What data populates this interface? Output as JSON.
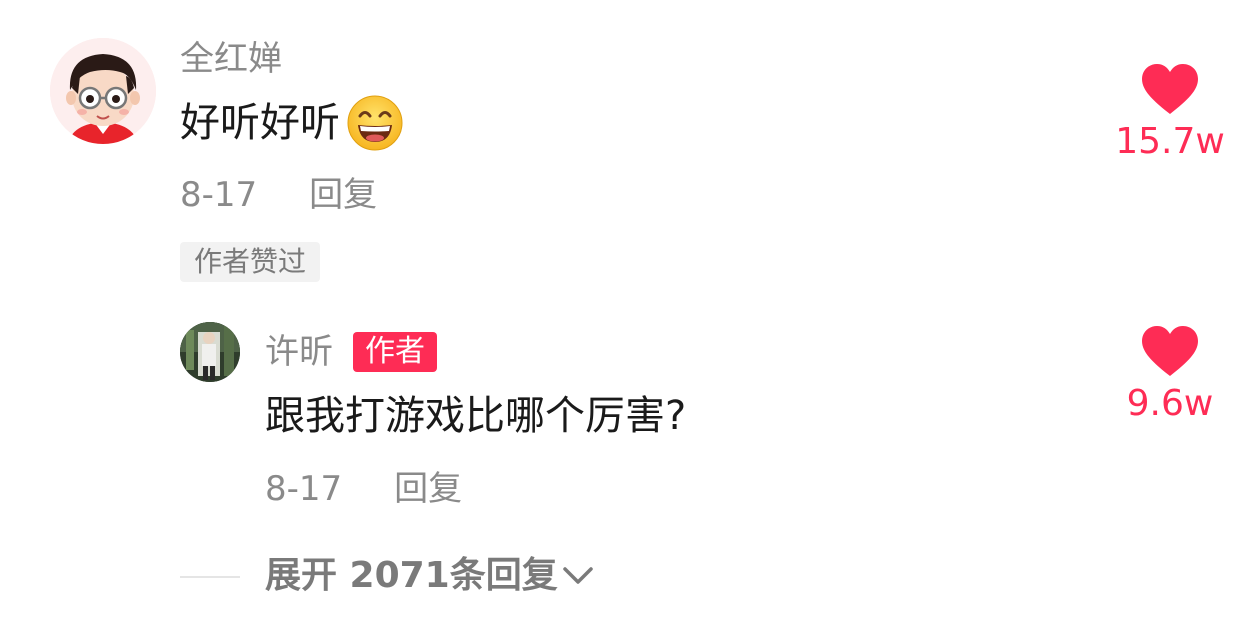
{
  "colors": {
    "accent": "#fe2c55",
    "muted": "#8a8a8a"
  },
  "comment": {
    "username": "全红婵",
    "text": "好听好听",
    "emoji_icon": "grinning-face-with-smiling-eyes-icon",
    "date": "8-17",
    "reply_label": "回复",
    "liked_by_author": "作者赞过",
    "like_count": "15.7w"
  },
  "reply": {
    "username": "许昕",
    "author_badge": "作者",
    "text": "跟我打游戏比哪个厉害?",
    "date": "8-17",
    "reply_label": "回复",
    "like_count": "9.6w"
  },
  "expand": {
    "label": "展开 2071条回复"
  }
}
